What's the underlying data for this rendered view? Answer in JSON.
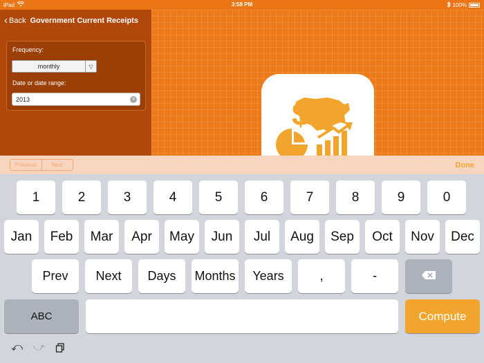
{
  "status": {
    "device": "iPad",
    "time": "3:58 PM",
    "battery": "100%"
  },
  "nav": {
    "back_label": "Back",
    "title": "Government Current Receipts"
  },
  "form": {
    "frequency_label": "Frequency:",
    "frequency_value": "monthly",
    "date_label": "Date or date range:",
    "date_value": "2013"
  },
  "accessory": {
    "prev_label": "Previous",
    "next_label": "Next",
    "done_label": "Done"
  },
  "keyboard": {
    "row1": [
      "1",
      "2",
      "3",
      "4",
      "5",
      "6",
      "7",
      "8",
      "9",
      "0"
    ],
    "row2": [
      "Jan",
      "Feb",
      "Mar",
      "Apr",
      "May",
      "Jun",
      "Jul",
      "Aug",
      "Sep",
      "Oct",
      "Nov",
      "Dec"
    ],
    "row3": [
      "Prev",
      "Next",
      "Days",
      "Months",
      "Years",
      ",",
      "-"
    ],
    "abc_label": "ABC",
    "compute_label": "Compute"
  },
  "colors": {
    "accent": "#e8650f",
    "compute": "#f2a52d",
    "done": "#f2a532"
  }
}
